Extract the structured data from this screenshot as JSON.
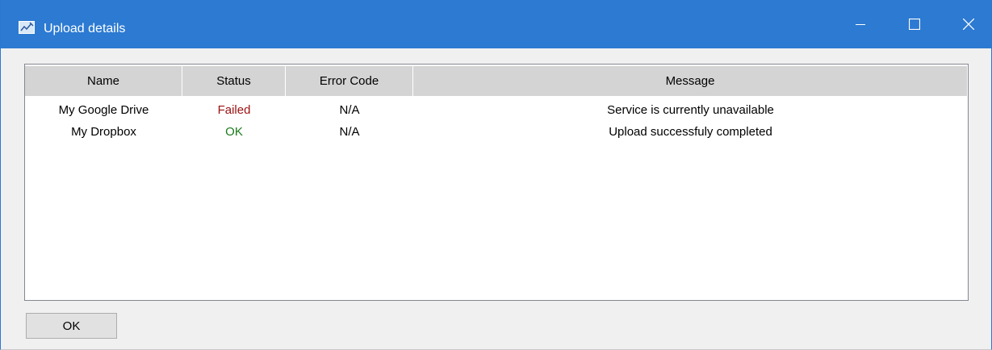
{
  "window": {
    "title": "Upload details",
    "controls": {
      "minimize_icon": "minimize-icon",
      "maximize_icon": "maximize-icon",
      "close_icon": "close-icon"
    }
  },
  "table": {
    "columns": [
      "Name",
      "Status",
      "Error Code",
      "Message"
    ],
    "rows": [
      {
        "name": "My Google Drive",
        "status": "Failed",
        "error_code": "N/A",
        "message": "Service is currently unavailable"
      },
      {
        "name": "My Dropbox",
        "status": "OK",
        "error_code": "N/A",
        "message": "Upload successfuly completed"
      }
    ]
  },
  "buttons": {
    "ok_label": "OK"
  },
  "colors": {
    "titlebar": "#2c7ad2",
    "status_failed": "#9b1010",
    "status_ok": "#1a7a1a",
    "header_bg": "#d4d4d4"
  }
}
